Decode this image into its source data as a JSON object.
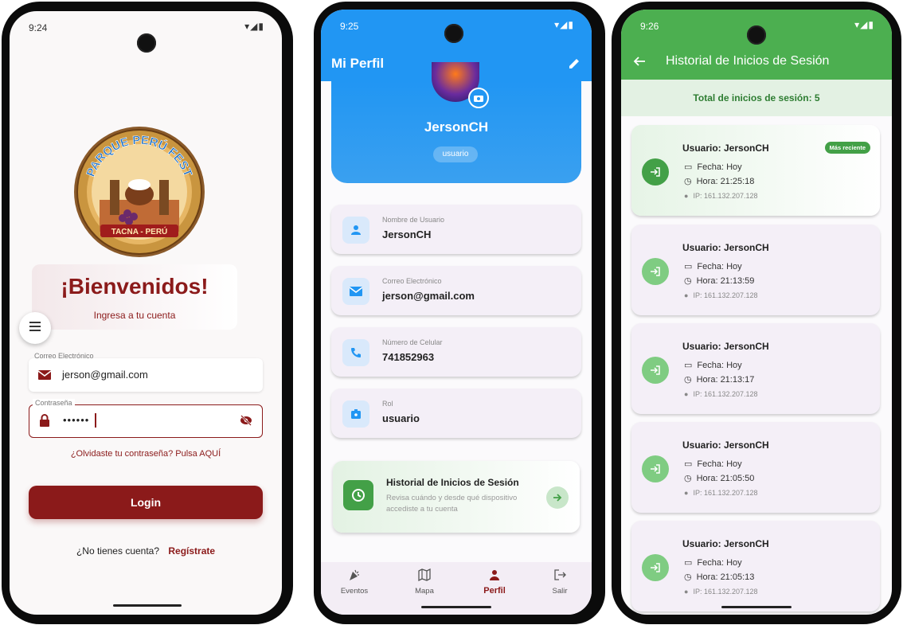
{
  "login": {
    "time": "9:24",
    "status_icons": "▾◢▮",
    "logo": {
      "ring": "PARQUE PERÚ FEST",
      "banner": "TACNA - PERÚ"
    },
    "welcome": "¡Bienvenidos!",
    "subtitle": "Ingresa a tu cuenta",
    "email_label": "Correo Electrónico",
    "email_value": "jerson@gmail.com",
    "password_label": "Contraseña",
    "password_value": "••••••",
    "forgot": "¿Olvidaste tu contraseña? Pulsa AQUÍ",
    "login_button": "Login",
    "no_account": "¿No tienes cuenta?",
    "register": "Regístrate"
  },
  "profile": {
    "time": "9:25",
    "status_icons": "▾◢▮",
    "title": "Mi Perfil",
    "username": "JersonCH",
    "role_badge": "usuario",
    "fields": [
      {
        "label": "Nombre de Usuario",
        "value": "JersonCH",
        "icon": "person-icon"
      },
      {
        "label": "Correo Electrónico",
        "value": "jerson@gmail.com",
        "icon": "mail-icon"
      },
      {
        "label": "Número de Celular",
        "value": "741852963",
        "icon": "phone-icon"
      },
      {
        "label": "Rol",
        "value": "usuario",
        "icon": "badge-icon"
      }
    ],
    "history_card": {
      "title": "Historial de Inicios de Sesión",
      "desc_line1": "Revisa cuándo y desde qué dispositivo",
      "desc_line2": "accediste a tu cuenta"
    },
    "nav": [
      {
        "label": "Eventos",
        "icon": "celebration-icon"
      },
      {
        "label": "Mapa",
        "icon": "map-icon"
      },
      {
        "label": "Perfil",
        "icon": "person-icon"
      },
      {
        "label": "Salir",
        "icon": "logout-icon"
      }
    ]
  },
  "history": {
    "time": "9:26",
    "status_icons": "▾◢▮",
    "title": "Historial de Inicios de Sesión",
    "total": "Total de inicios de sesión: 5",
    "recent_badge": "Más reciente",
    "sessions": [
      {
        "user": "Usuario: JersonCH",
        "date": "Fecha: Hoy",
        "time": "Hora: 21:25:18",
        "ip": "IP: 161.132.207.128"
      },
      {
        "user": "Usuario: JersonCH",
        "date": "Fecha: Hoy",
        "time": "Hora: 21:13:59",
        "ip": "IP: 161.132.207.128"
      },
      {
        "user": "Usuario: JersonCH",
        "date": "Fecha: Hoy",
        "time": "Hora: 21:13:17",
        "ip": "IP: 161.132.207.128"
      },
      {
        "user": "Usuario: JersonCH",
        "date": "Fecha: Hoy",
        "time": "Hora: 21:05:50",
        "ip": "IP: 161.132.207.128"
      },
      {
        "user": "Usuario: JersonCH",
        "date": "Fecha: Hoy",
        "time": "Hora: 21:05:13",
        "ip": "IP: 161.132.207.128"
      }
    ]
  },
  "colors": {
    "maroon": "#8b1a1a",
    "blue": "#2196f3",
    "green": "#4caf50"
  }
}
